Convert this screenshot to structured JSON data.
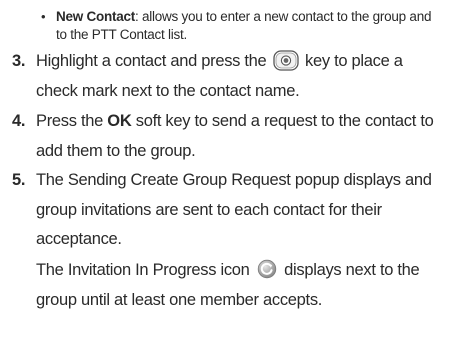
{
  "bullet": {
    "symbol": "•",
    "heading": "New Contact",
    "text_line1": ": allows you to enter a new contact to the group and",
    "text_line2": "to the PTT Contact list."
  },
  "steps": [
    {
      "number": "3.",
      "line1_before": "Highlight a contact and press the",
      "key_icon": "center-select-key-icon",
      "line1_after": "key to place a",
      "line2": "check mark next to the contact name."
    },
    {
      "number": "4.",
      "line1_before": "Press the",
      "line1_bold": "OK",
      "line1_after": "soft key to send a request to the contact to",
      "line2": "add them to the group."
    },
    {
      "number": "5.",
      "line1": "The Sending Create Group Request popup displays and",
      "line2": "group invitations are sent to each contact for their",
      "line3": "acceptance."
    }
  ],
  "note": {
    "line1_before": "The Invitation In Progress icon",
    "icon": "invitation-in-progress-icon",
    "line1_after": "displays next to the",
    "line2": "group until at least one member accepts."
  },
  "colors": {
    "text": "#2a2a2a",
    "background": "#ffffff",
    "icon_gray": "#9a9a9a"
  }
}
